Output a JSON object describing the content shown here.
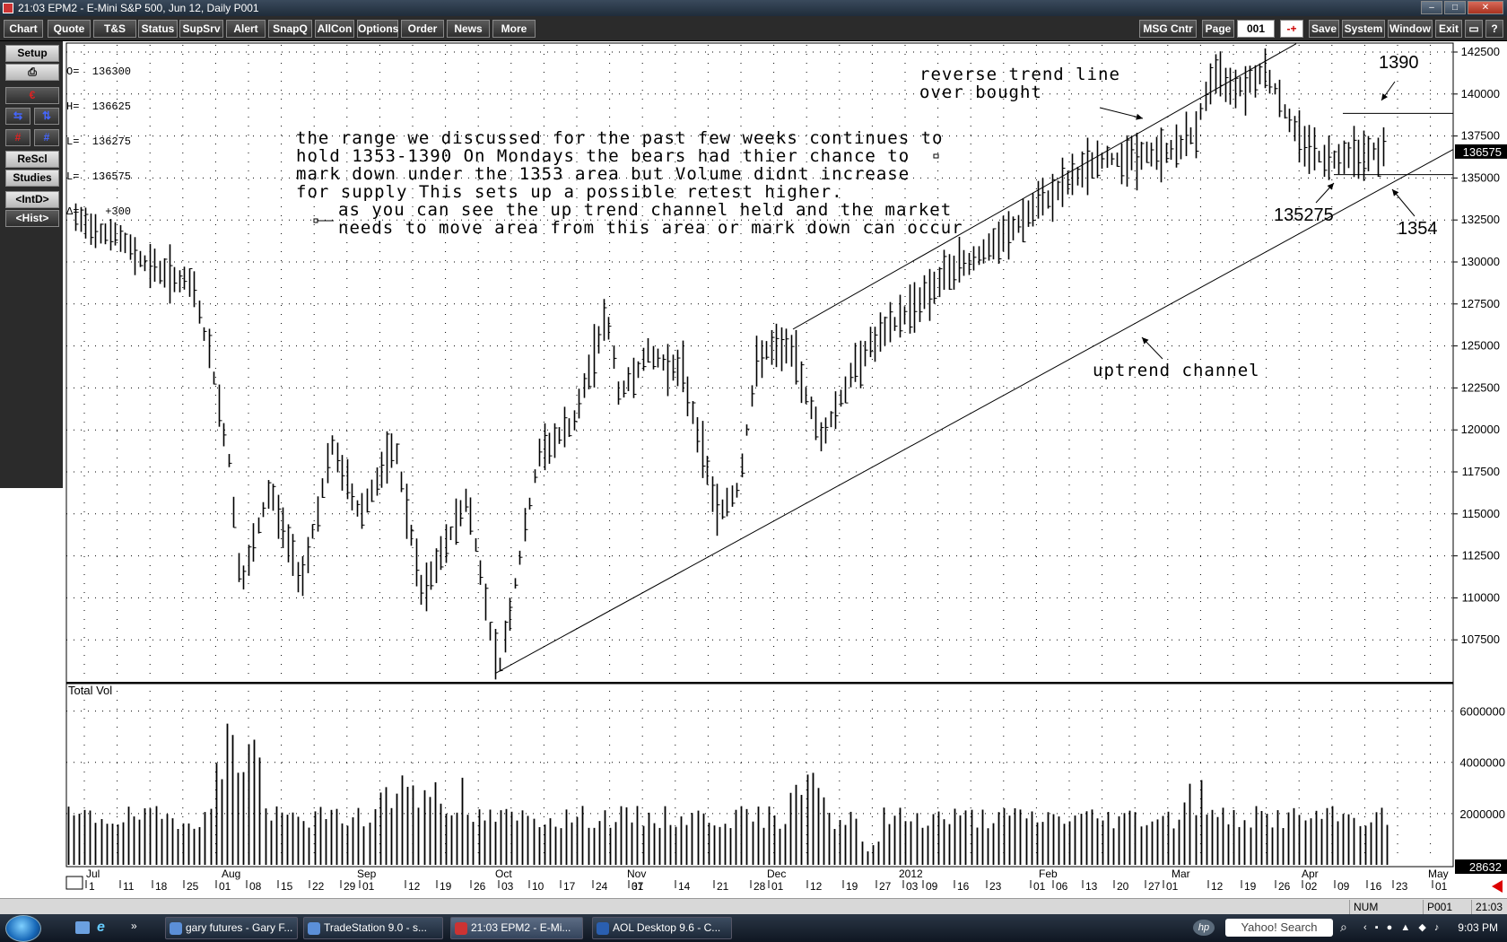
{
  "window": {
    "title": "21:03   EPM2 - E-Mini S&P 500, Jun 12, Daily   P001"
  },
  "toolbar": {
    "buttons": [
      "Chart",
      "Quote",
      "T&S",
      "Status",
      "SupSrv",
      "Alert",
      "SnapQ",
      "AllCon",
      "Options",
      "Order",
      "News",
      "More"
    ],
    "msg_center": "MSG Cntr",
    "page_label": "Page",
    "page_value": "001",
    "plus_minus": "-+",
    "right_buttons": [
      "Save",
      "System",
      "Window",
      "Exit"
    ]
  },
  "left_panel": {
    "setup": "Setup",
    "rescl": "ReScl",
    "studies": "Studies",
    "intd": "<IntD>",
    "hist": "<Hist>"
  },
  "ohlc": {
    "o": "O=  136300",
    "h": "H=  136625",
    "l1": "L=  136275",
    "l2": "L=  136575",
    "d": "Δ=    +300"
  },
  "chart_data": [
    {
      "type": "bar",
      "name": "price",
      "ylim": [
        105000,
        142500
      ],
      "y_ticks": [
        142500,
        140000,
        137500,
        135000,
        132500,
        130000,
        127500,
        125000,
        122500,
        120000,
        117500,
        115000,
        112500,
        110000,
        107500
      ],
      "y_tick_labels": [
        "142500",
        "140000",
        "137500",
        "135000",
        "132500",
        "130000",
        "127500",
        "125000",
        "122500",
        "120000",
        "117500",
        "115000",
        "112500",
        "110000",
        "107500"
      ],
      "current_price_label": "136575",
      "current_price": 136575,
      "x_month_labels": [
        "Jul",
        "Aug",
        "Sep",
        "Oct",
        "Nov",
        "Dec",
        "2012",
        "Feb",
        "Mar",
        "Apr",
        "May"
      ],
      "x_day_labels": [
        "1",
        "11",
        "18",
        "25",
        "01",
        "08",
        "15",
        "22",
        "29",
        "01",
        "12",
        "19",
        "26",
        "03",
        "10",
        "17",
        "24",
        "31",
        "07",
        "14",
        "21",
        "28",
        "01",
        "12",
        "19",
        "27",
        "03",
        "09",
        "16",
        "23",
        "01",
        "06",
        "13",
        "20",
        "27",
        "01",
        "12",
        "19",
        "26",
        "02",
        "09",
        "16",
        "23",
        "01"
      ],
      "annotations": {
        "reverse_line1": "reverse trend line",
        "reverse_line2": "over bought",
        "comment_line1": "the range we discussed for the past few weeks continues to",
        "comment_line2": "hold 1353-1390 On Mondays the bears had thier chance to",
        "comment_line3": "mark down under the 1353 area but Volume didnt increase",
        "comment_line4": "for supply This sets up a possible retest higher.",
        "comment_line5": "as you can see the up trend channel held and the market",
        "comment_line6": "needs to move area from this area or mark down can occur",
        "label_1390": "1390",
        "label_135275": "135275",
        "label_1354": "1354",
        "uptrend": "uptrend channel"
      },
      "trend_anchors": {
        "channel_start": [
          105500,
          "2011-10-03"
        ],
        "points": [
          [
            10,
            118000,
            120500
          ],
          [
            11,
            119500,
            120000
          ],
          [
            12,
            118500,
            119500
          ],
          [
            13,
            116500,
            118500
          ],
          [
            14,
            116800,
            117800
          ],
          [
            15,
            117000,
            117500
          ],
          [
            16,
            117000,
            117200
          ],
          [
            17,
            116200,
            117200
          ],
          [
            18,
            115500,
            116500
          ],
          [
            19,
            114700,
            115800
          ],
          [
            20,
            115200,
            115500
          ],
          [
            21,
            116800,
            118300
          ],
          [
            22,
            117700,
            118400
          ],
          [
            23,
            117800,
            118000
          ],
          [
            24,
            117700,
            118100
          ],
          [
            25,
            117500,
            117800
          ]
        ]
      }
    },
    {
      "type": "bar",
      "name": "Total Vol",
      "title": "Total Vol",
      "ylim": [
        0,
        7000000
      ],
      "y_ticks": [
        6000000,
        4000000,
        2000000
      ],
      "y_tick_labels": [
        "6000000",
        "4000000",
        "2000000"
      ],
      "current_label": "28632"
    }
  ],
  "statusbar": {
    "num": "NUM",
    "page": "P001",
    "time": "21:03"
  },
  "taskbar": {
    "tasks": [
      "gary futures - Gary F...",
      "TradeStation 9.0 - s...",
      "21:03   EPM2 - E-Mi...",
      "AOL Desktop 9.6 - C..."
    ],
    "search": "Yahoo! Search",
    "clock": "9:03 PM",
    "hp": "hp"
  }
}
